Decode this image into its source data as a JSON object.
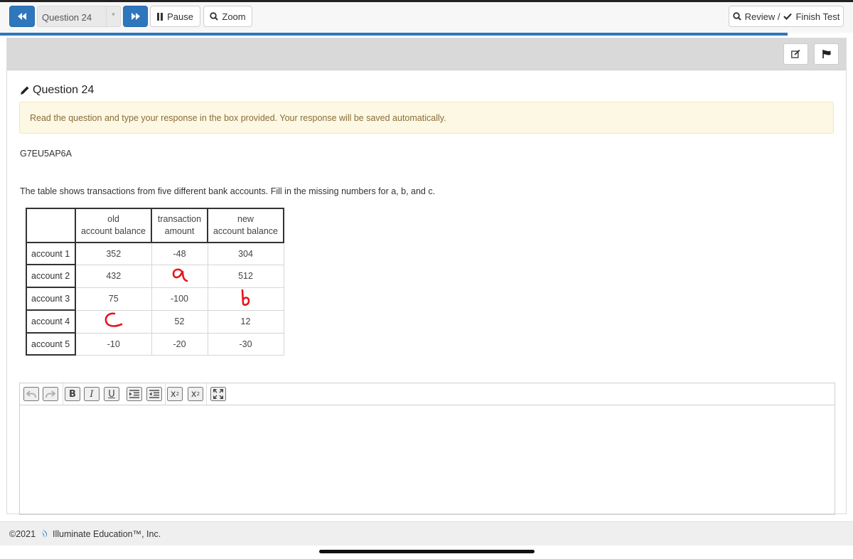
{
  "topbar": {
    "question_select": "Question 24",
    "pause_label": "Pause",
    "zoom_label": "Zoom",
    "review_label": "Review /",
    "finish_label": "Finish Test"
  },
  "question": {
    "title": "Question 24",
    "notice": "Read the question and type your response in the box provided. Your response will be saved automatically.",
    "code": "G7EU5AP6A",
    "prompt": "The table shows transactions from five different bank accounts. Fill in the missing numbers for a, b, and c."
  },
  "table": {
    "headers": [
      {
        "line1": "old",
        "line2": "account balance"
      },
      {
        "line1": "transaction",
        "line2": "amount"
      },
      {
        "line1": "new",
        "line2": "account balance"
      }
    ],
    "rows": [
      {
        "label": "account 1",
        "old": "352",
        "txn": "-48",
        "new": "304"
      },
      {
        "label": "account 2",
        "old": "432",
        "txn": "a",
        "new": "512"
      },
      {
        "label": "account 3",
        "old": "75",
        "txn": "-100",
        "new": "b"
      },
      {
        "label": "account 4",
        "old": "c",
        "txn": "52",
        "new": "12"
      },
      {
        "label": "account 5",
        "old": "-10",
        "txn": "-20",
        "new": "-30"
      }
    ]
  },
  "editor": {
    "bold": "B",
    "italic": "I",
    "underline": "U",
    "subscript": "x",
    "subscript_mark": "2",
    "superscript": "x",
    "superscript_mark": "2"
  },
  "footer": {
    "copyright": "©2021",
    "company": "Illuminate Education™, Inc."
  },
  "colors": {
    "accent": "#2f77bd",
    "notice_bg": "#fcf8e3",
    "notice_text": "#8a6d3b",
    "handwriting": "#e8141b"
  }
}
